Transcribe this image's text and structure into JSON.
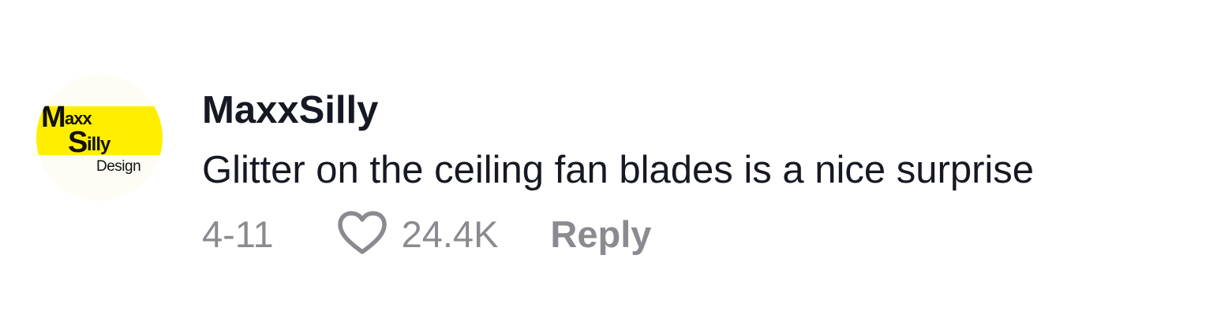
{
  "comment": {
    "avatar": {
      "logo_lines": [
        "Maxx",
        "Silly",
        "Design"
      ],
      "colors": {
        "band": "#ffee00",
        "background": "#fefdf5",
        "ink": "#111111"
      }
    },
    "username": "MaxxSilly",
    "text": "Glitter on the ceiling fan blades is a nice surprise",
    "date": "4-11",
    "like_count": "24.4K",
    "reply_label": "Reply",
    "icons": {
      "like": "heart-outline-icon"
    },
    "colors": {
      "primary_text": "#161823",
      "secondary_text": "#8a8b91"
    }
  }
}
